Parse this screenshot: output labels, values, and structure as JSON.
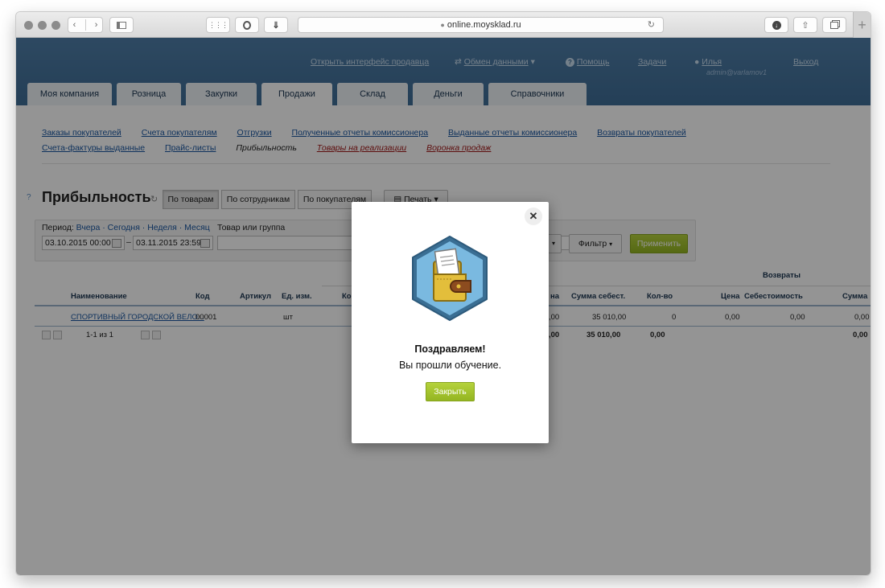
{
  "browser": {
    "url": "online.moysklad.ru",
    "lock_icon": "lock-icon"
  },
  "header": {
    "seller_link": "Открыть интерфейс продавца",
    "exchange_label": "Обмен данными",
    "help_label": "Помощь",
    "tasks_label": "Задачи",
    "user_name": "Илья",
    "user_login": "admin@varlamov1",
    "logout_label": "Выход"
  },
  "tabs": [
    "Моя компания",
    "Розница",
    "Закупки",
    "Продажи",
    "Склад",
    "Деньги",
    "Справочники"
  ],
  "subnav": {
    "row1": [
      "Заказы покупателей",
      "Счета покупателям",
      "Отгрузки",
      "Полученные отчеты комиссионера",
      "Выданные отчеты комиссионера",
      "Возвраты покупателей"
    ],
    "row2": [
      "Счета-фактуры выданные",
      "Прайс-листы",
      "Прибыльность",
      "Товары на реализации",
      "Воронка продаж"
    ]
  },
  "page": {
    "title": "Прибыльность",
    "help_mark": "?",
    "view_tabs": [
      "По товарам",
      "По сотрудникам",
      "По покупателям"
    ],
    "print_label": "Печать"
  },
  "filter": {
    "period_label": "Период:",
    "quick_periods": "Вчера · Сегодня · Неделя · Месяц",
    "date_from": "03.10.2015 00:00",
    "date_sep": "–",
    "date_to": "03.11.2015 23:59",
    "product_label": "Товар или группа",
    "product_value": "",
    "filter_label": "Фильтр",
    "apply_label": "Применить"
  },
  "table": {
    "group_header": "Возвраты",
    "headers": [
      "Наименование",
      "Код",
      "Артикул",
      "Ед. изм.",
      "Ко",
      "на",
      "Сумма себест.",
      "Кол-во",
      "Цена",
      "Себестоимость",
      "Сумма"
    ],
    "row": {
      "name": "СПОРТИВНЫЙ ГОРОДСКОЙ ВЕЛО...",
      "code": "00001",
      "unit": "шт",
      "c1": ",00",
      "cost_sum": "35 010,00",
      "qty": "0",
      "price": "0,00",
      "cost": "0,00",
      "sum": "0,00"
    },
    "footer": {
      "pages": "1-1 из 1",
      "c1": ",00",
      "cost_sum": "35 010,00",
      "qty": "0,00",
      "sum": "0,00"
    }
  },
  "modal": {
    "title": "Поздравляем!",
    "text": "Вы прошли обучение.",
    "button": "Закрыть",
    "close_glyph": "✕"
  }
}
